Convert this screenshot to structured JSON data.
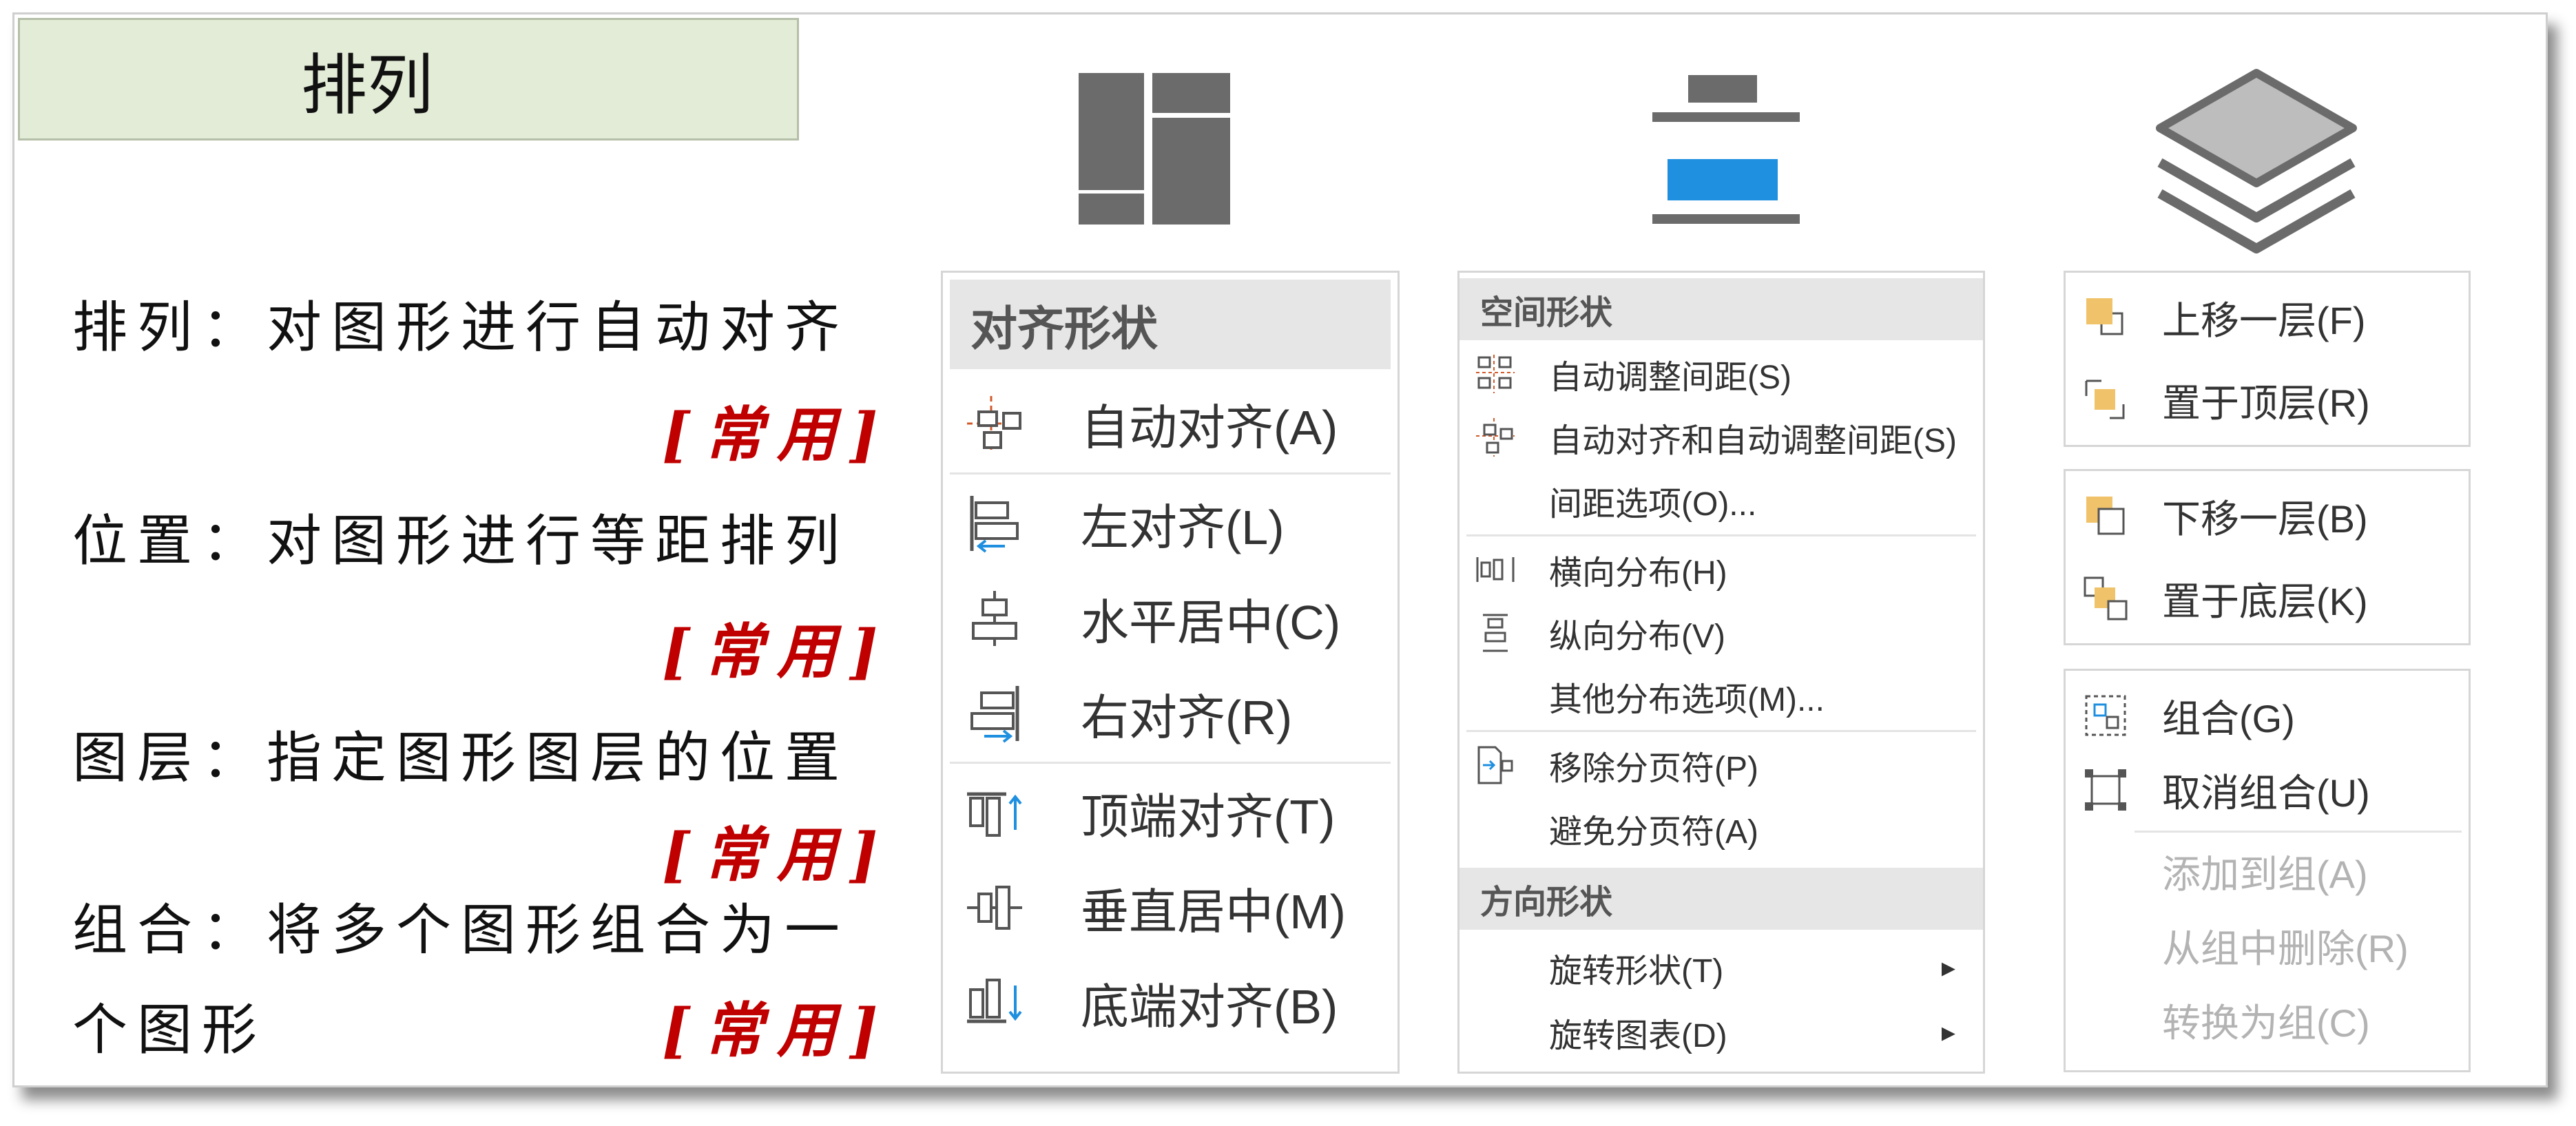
{
  "title": "排列",
  "descriptions": [
    {
      "text": "排列：对图形进行自动对齐",
      "tag": "[常用]"
    },
    {
      "text": "位置：对图形进行等距排列",
      "tag": "[常用]"
    },
    {
      "text": "图层：指定图形图层的位置",
      "tag": "[常用]"
    },
    {
      "text_line1": "组合：将多个图形组合为一",
      "text_line2": "个图形",
      "tag": "[常用]"
    }
  ],
  "icons": {
    "arrange": "arrange-grid-icon",
    "position": "position-distribute-icon",
    "layers": "layers-stack-icon"
  },
  "align_panel": {
    "header": "对齐形状",
    "items": [
      {
        "label": "自动对齐(A)",
        "icon": "auto-align-icon"
      },
      {
        "label": "左对齐(L)",
        "icon": "align-left-icon"
      },
      {
        "label": "水平居中(C)",
        "icon": "align-center-icon"
      },
      {
        "label": "右对齐(R)",
        "icon": "align-right-icon"
      },
      {
        "label": "顶端对齐(T)",
        "icon": "align-top-icon"
      },
      {
        "label": "垂直居中(M)",
        "icon": "align-middle-icon"
      },
      {
        "label": "底端对齐(B)",
        "icon": "align-bottom-icon"
      }
    ]
  },
  "space_panel": {
    "header1": "空间形状",
    "items1": [
      {
        "label": "自动调整间距(S)",
        "icon": "auto-spacing-icon"
      },
      {
        "label": "自动对齐和自动调整间距(S)",
        "icon": "auto-align-space-icon"
      },
      {
        "label": "间距选项(O)...",
        "icon": ""
      },
      {
        "label": "横向分布(H)",
        "icon": "distribute-horizontal-icon"
      },
      {
        "label": "纵向分布(V)",
        "icon": "distribute-vertical-icon"
      },
      {
        "label": "其他分布选项(M)...",
        "icon": ""
      },
      {
        "label": "移除分页符(P)",
        "icon": "remove-page-break-icon"
      },
      {
        "label": "避免分页符(A)",
        "icon": ""
      }
    ],
    "header2": "方向形状",
    "items2": [
      {
        "label": "旋转形状(T)",
        "arrow": "▸"
      },
      {
        "label": "旋转图表(D)",
        "arrow": "▸"
      }
    ]
  },
  "layer_panel": {
    "group1": [
      {
        "label": "上移一层(F)",
        "icon": "bring-forward-icon"
      },
      {
        "label": "置于顶层(R)",
        "icon": "bring-to-front-icon"
      }
    ],
    "group2": [
      {
        "label": "下移一层(B)",
        "icon": "send-backward-icon"
      },
      {
        "label": "置于底层(K)",
        "icon": "send-to-back-icon"
      }
    ],
    "group3": [
      {
        "label": "组合(G)",
        "icon": "group-icon",
        "enabled": true
      },
      {
        "label": "取消组合(U)",
        "icon": "ungroup-icon",
        "enabled": true
      },
      {
        "label": "添加到组(A)",
        "icon": "",
        "enabled": false
      },
      {
        "label": "从组中删除(R)",
        "icon": "",
        "enabled": false
      },
      {
        "label": "转换为组(C)",
        "icon": "",
        "enabled": false
      }
    ]
  },
  "colors": {
    "accent_blue": "#1f8fe0",
    "tag_red": "#c00000",
    "title_bg": "#e3ecd7",
    "layer_yellow": "#f0c36a"
  }
}
